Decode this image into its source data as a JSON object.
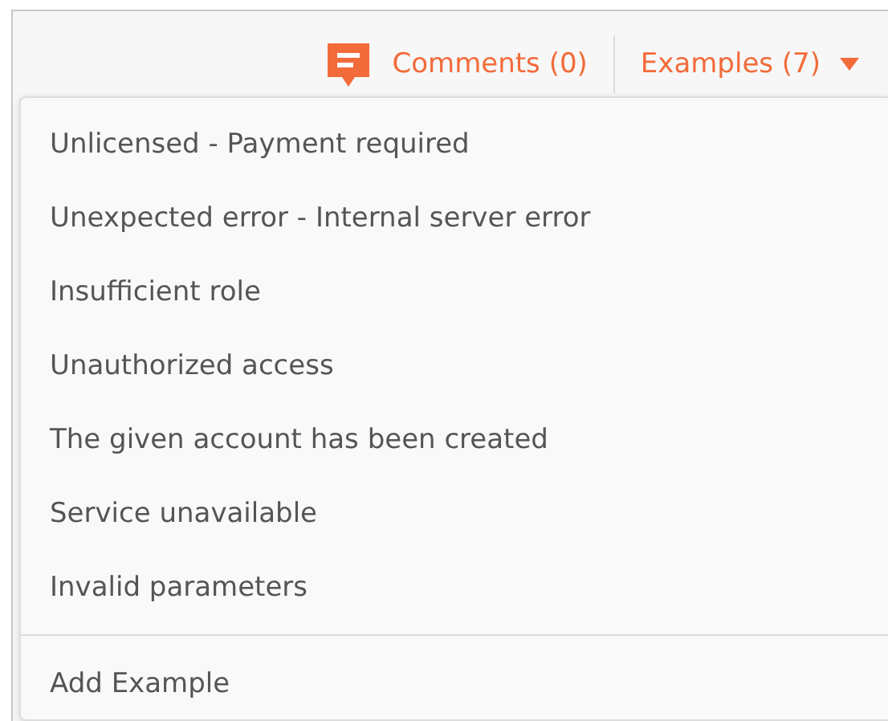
{
  "header": {
    "comments": "Comments (0)",
    "examples": "Examples (7)"
  },
  "menu": {
    "items": [
      {
        "label": "Unlicensed - Payment required"
      },
      {
        "label": "Unexpected error - Internal server error"
      },
      {
        "label": "Insufficient role"
      },
      {
        "label": "Unauthorized access"
      },
      {
        "label": "The given account has been created"
      },
      {
        "label": "Service unavailable"
      },
      {
        "label": "Invalid parameters"
      }
    ],
    "footer": "Add Example"
  }
}
